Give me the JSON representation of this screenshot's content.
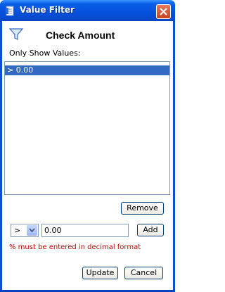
{
  "window": {
    "title": "Value Filter",
    "icon": "app-document-icon"
  },
  "header": {
    "icon": "filter-funnel-icon",
    "title": "Check Amount"
  },
  "list": {
    "label": "Only Show Values:",
    "items": [
      "> 0.00"
    ],
    "selected_index": 0
  },
  "buttons": {
    "remove": "Remove",
    "add": "Add",
    "update": "Update",
    "cancel": "Cancel"
  },
  "editor": {
    "operator": ">",
    "value": "0.00"
  },
  "hint": "% must be entered in decimal format",
  "colors": {
    "titlebar": "#0652dc",
    "selection": "#316ac5",
    "hint": "#cc0000"
  }
}
